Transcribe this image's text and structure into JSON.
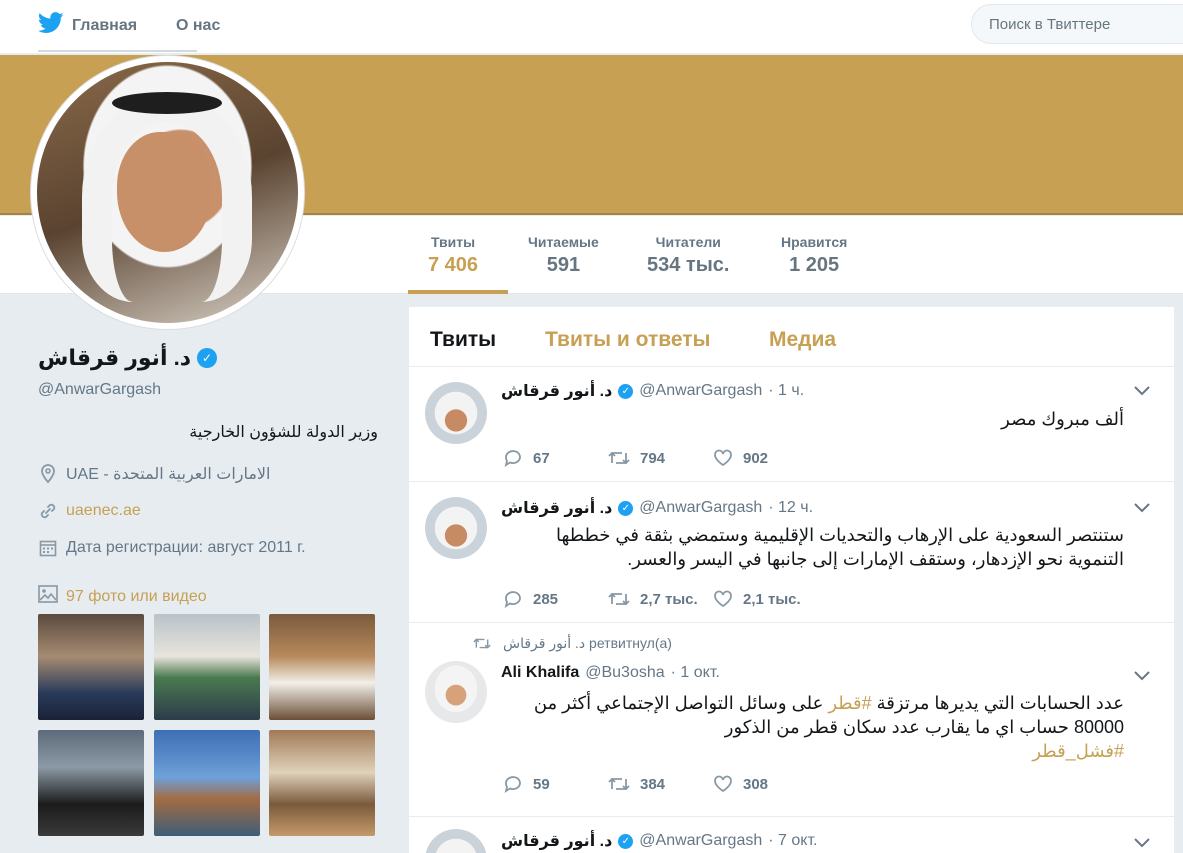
{
  "nav": {
    "home_label": "Главная",
    "about_label": "О нас",
    "search_placeholder": "Поиск в Твиттере"
  },
  "colors": {
    "accent": "#c7a054",
    "verified": "#1da1f2"
  },
  "stats": [
    {
      "label": "Твиты",
      "value": "7 406"
    },
    {
      "label": "Читаемые",
      "value": "591"
    },
    {
      "label": "Читатели",
      "value": "534 тыс."
    },
    {
      "label": "Нравится",
      "value": "1 205"
    }
  ],
  "profile": {
    "name": "د. أنور قرقاش",
    "handle": "@AnwarGargash",
    "bio": "وزير الدولة للشؤون الخارجية",
    "location": "UAE - الامارات العربية المتحدة",
    "website": "uaenec.ae",
    "joined": "Дата регистрации: август 2011 г.",
    "photos_label": "97 фото или видео"
  },
  "timeline": {
    "tabs": [
      "Твиты",
      "Твиты и ответы",
      "Медиа"
    ],
    "tweets": [
      {
        "name": "د. أنور قرقاش",
        "handle": "@AnwarGargash",
        "time": "· 1 ч.",
        "text": "ألف مبروك مصر",
        "replies": "67",
        "retweets": "794",
        "likes": "902"
      },
      {
        "name": "د. أنور قرقاش",
        "handle": "@AnwarGargash",
        "time": "· 12 ч.",
        "text": "ستنتصر السعودية على الإرهاب والتحديات الإقليمية وستمضي  بثقة في خططها التنموية نحو الإزدهار، وستقف الإمارات إلى جانبها في اليسر والعسر.",
        "replies": "285",
        "retweets": "2,7 тыс.",
        "likes": "2,1 тыс."
      },
      {
        "retweet_context": "د. أنور قرقاش ретвитнул(а)",
        "name": "Ali Khalifa",
        "handle": "@Bu3osha",
        "time": "· 1 окт.",
        "text_part1": "عدد الحسابات التي يديرها مرتزقة ",
        "hashtag1": "#قطر",
        "text_part2": " على وسائل التواصل الإجتماعي أكثر من 80000 حساب  اي ما يقارب عدد سكان قطر من الذكور",
        "hashtag2": "#فشل_قطر",
        "replies": "59",
        "retweets": "384",
        "likes": "308"
      },
      {
        "name": "د. أنور قرقاش",
        "handle": "@AnwarGargash",
        "time": "· 7 окт."
      }
    ]
  }
}
